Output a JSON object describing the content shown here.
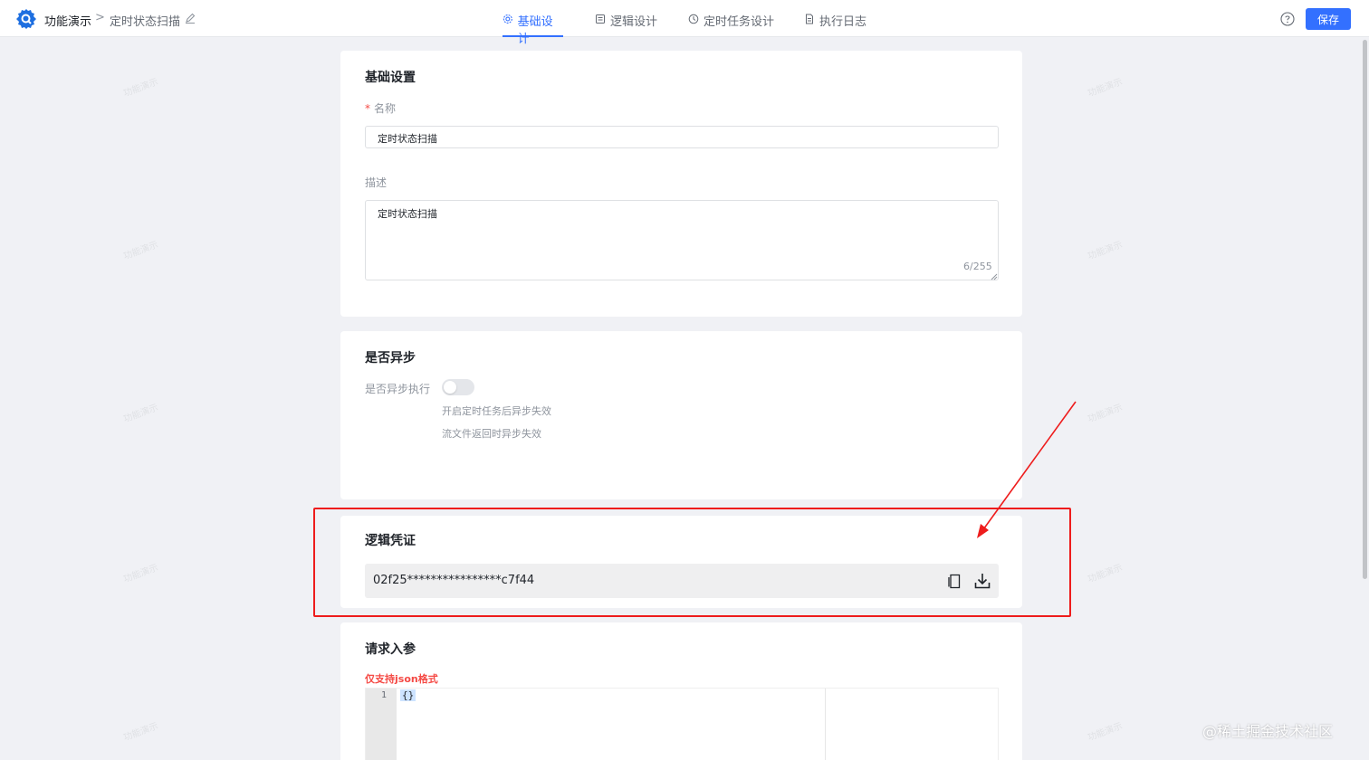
{
  "header": {
    "breadcrumb": {
      "app": "功能演示",
      "separator": ">",
      "page": "定时状态扫描"
    },
    "tabs": [
      {
        "label": "基础设计",
        "icon": "gear-icon",
        "active": true
      },
      {
        "label": "逻辑设计",
        "icon": "document-icon",
        "active": false
      },
      {
        "label": "定时任务设计",
        "icon": "clock-icon",
        "active": false
      },
      {
        "label": "执行日志",
        "icon": "file-icon",
        "active": false
      }
    ],
    "save_label": "保存",
    "accent_color": "#3370ff"
  },
  "basic": {
    "title": "基础设置",
    "name_label": "名称",
    "name_required_mark": "*",
    "name_value": "定时状态扫描",
    "desc_label": "描述",
    "desc_value": "定时状态扫描",
    "desc_counter": "6/255"
  },
  "async": {
    "title": "是否异步",
    "toggle_label": "是否异步执行",
    "toggle_on": false,
    "hints": [
      "开启定时任务后异步失效",
      "流文件返回时异步失效"
    ]
  },
  "credential": {
    "title": "逻辑凭证",
    "value": "02f25****************c7f44"
  },
  "request": {
    "title": "请求入参",
    "note": "仅支持json格式",
    "line_number": "1",
    "code": "{}"
  },
  "watermark_text": "功能演示",
  "footer_mark": "@稀土掘金技术社区",
  "annotation_color": "#ee1c1c"
}
